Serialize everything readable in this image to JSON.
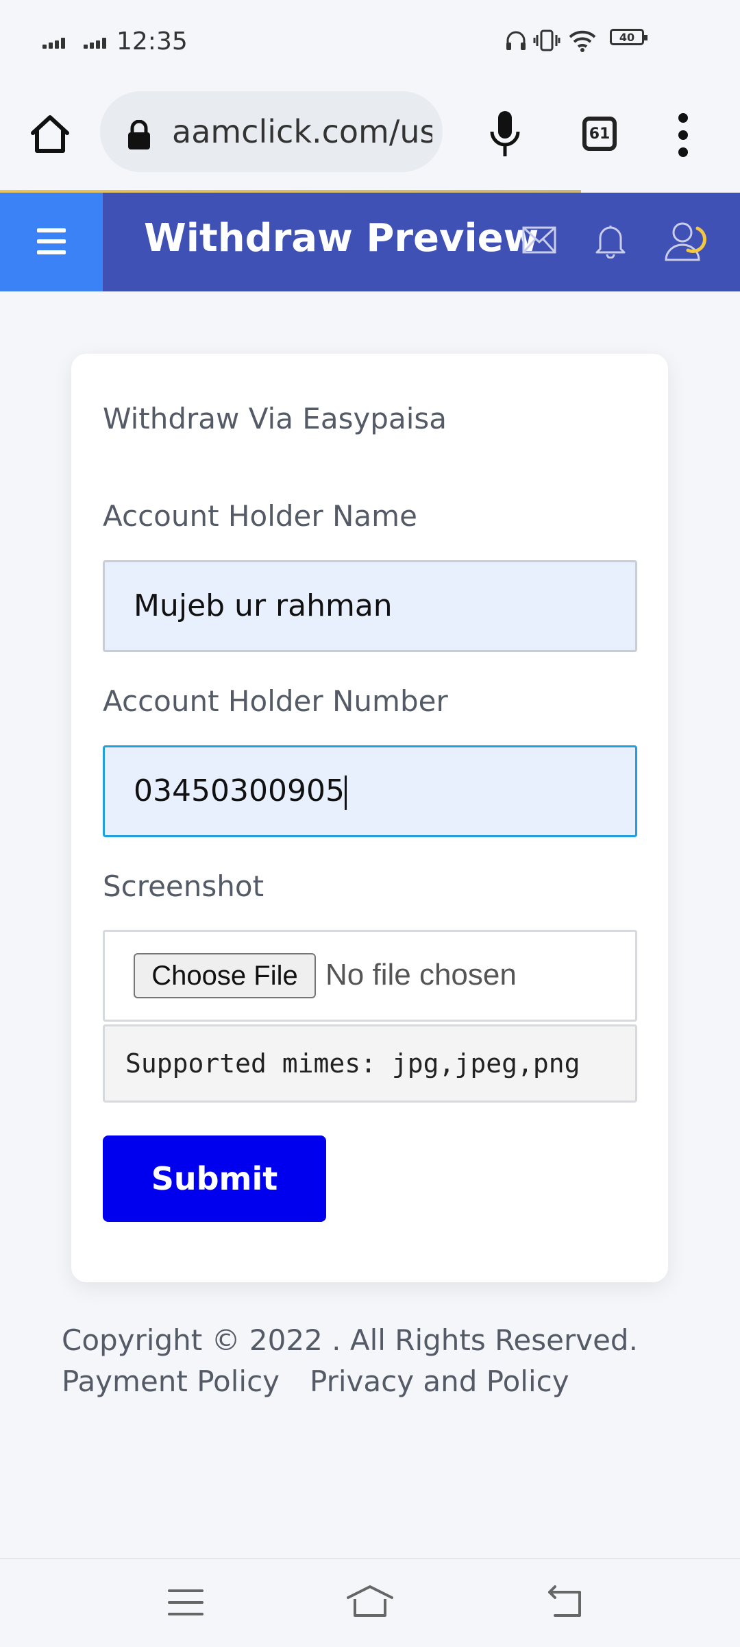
{
  "status_bar": {
    "time": "12:35",
    "battery": "40",
    "icons": [
      "signal-icon",
      "signal-icon",
      "headphones-icon",
      "vibrate-icon",
      "wifi-icon",
      "battery-icon"
    ]
  },
  "browser": {
    "url": "aamclick.com/us",
    "tab_count": "61",
    "icons": [
      "home-icon",
      "lock-icon",
      "microphone-icon",
      "tabs-icon",
      "more-vert-icon"
    ]
  },
  "header": {
    "title": "Withdraw Preview",
    "background_color": "#3f51b5",
    "menu_button_color": "#3b82f6",
    "icons": [
      "menu-icon",
      "mail-icon",
      "bell-icon",
      "user-icon"
    ]
  },
  "form": {
    "title": "Withdraw Via Easypaisa",
    "name_label": "Account Holder Name",
    "name_value": "Mujeb ur rahman",
    "number_label": "Account Holder Number",
    "number_value": "03450300905",
    "screenshot_label": "Screenshot",
    "choose_file_label": "Choose File",
    "no_file_text": "No file chosen",
    "mimes_hint": "Supported mimes: jpg,jpeg,png",
    "submit_label": "Submit",
    "submit_color": "#0000ee"
  },
  "footer": {
    "copyright": "Copyright © 2022 . All Rights Reserved.",
    "links": [
      "Payment Policy",
      "Privacy and Policy"
    ]
  },
  "nav_bar": {
    "icons": [
      "recent-apps-icon",
      "home-nav-icon",
      "back-icon"
    ]
  }
}
